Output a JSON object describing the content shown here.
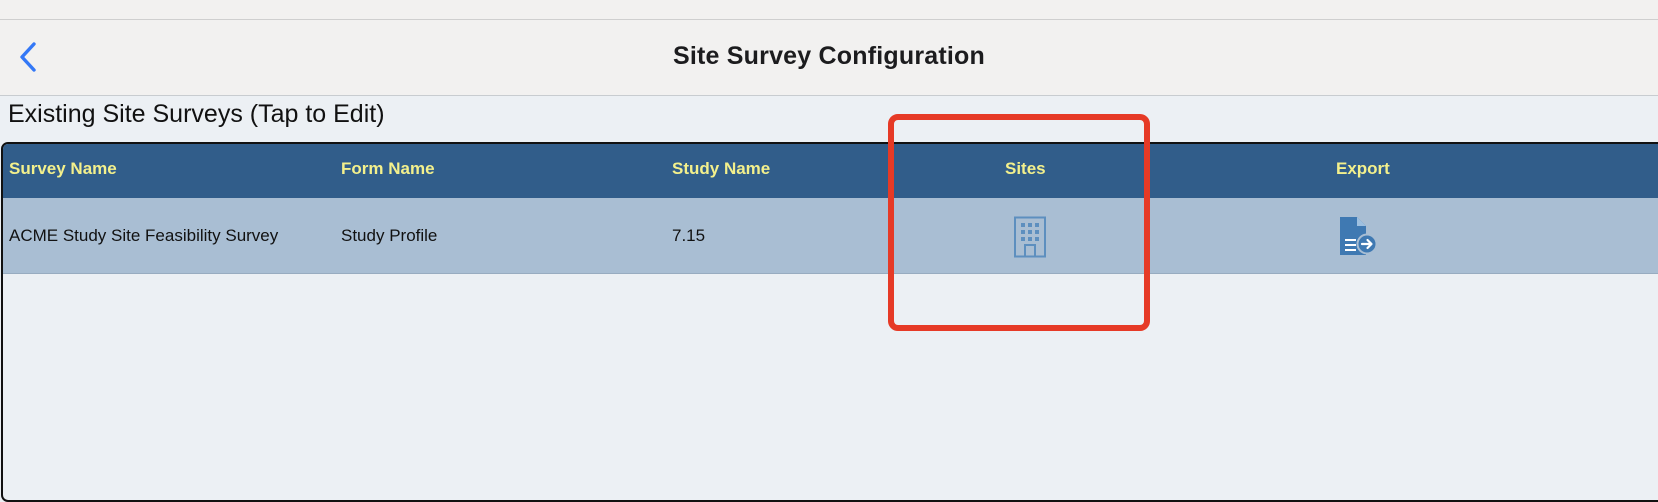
{
  "nav": {
    "title": "Site Survey Configuration",
    "back_icon": "chevron-left-icon",
    "accent_color": "#3478f6"
  },
  "section": {
    "title": "Existing Site Surveys (Tap to Edit)"
  },
  "table": {
    "header_bg": "#315d8a",
    "header_text_color": "#f3f08c",
    "columns": [
      "Survey Name",
      "Form Name",
      "Study Name",
      "Sites",
      "Export"
    ],
    "rows": [
      {
        "survey_name": "ACME Study Site Feasibility Survey",
        "form_name": "Study Profile",
        "study_name": "7.15",
        "sites_icon": "building-icon",
        "export_icon": "document-export-icon"
      }
    ]
  },
  "annotation": {
    "highlight_color": "#e63a26"
  }
}
